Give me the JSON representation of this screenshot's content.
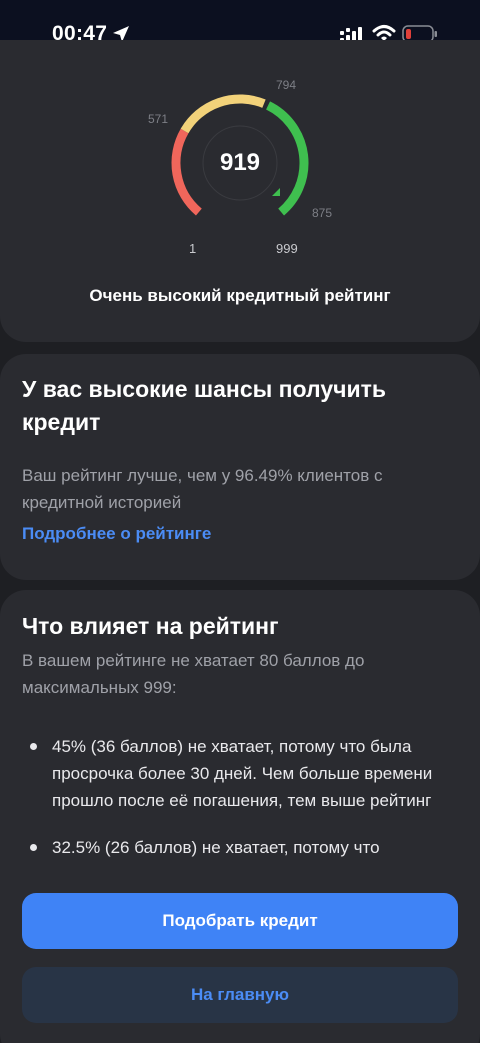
{
  "status_bar": {
    "time": "00:47",
    "icons": [
      "location-arrow-icon",
      "signal-icon",
      "wifi-icon",
      "battery-low-icon"
    ],
    "battery_color": "#e0403a"
  },
  "score_card": {
    "score": "919",
    "score_value": 919,
    "scale_min": "1",
    "scale_max": "999",
    "threshold_labels": [
      "571",
      "794",
      "875"
    ],
    "caption": "Очень высокий кредитный рейтинг",
    "segment_colors": {
      "low": "#f0665b",
      "mid": "#f2d27a",
      "high": "#3fbf4f"
    }
  },
  "chances_card": {
    "title": "У вас высокие шансы получить кредит",
    "text": "Ваш рейтинг лучше, чем у 96.49% клиентов с кредитной историей",
    "link": "Подробнее о рейтинге"
  },
  "factors_card": {
    "title": "Что влияет на рейтинг",
    "text": "В вашем рейтинге не хватает 80 баллов до максимальных 999:",
    "items": [
      "45% (36 баллов) не хватает, потому что была просрочка более 30 дней. Чем больше времени прошло после её погашения, тем выше рейтинг",
      "32.5% (26 баллов) не хватает, потому что"
    ]
  },
  "buttons": {
    "primary": "Подобрать кредит",
    "secondary": "На главную"
  },
  "colors": {
    "accent": "#3f83f6",
    "link": "#4b8cf5",
    "background": "#1e1f23",
    "card": "#2a2b30"
  }
}
